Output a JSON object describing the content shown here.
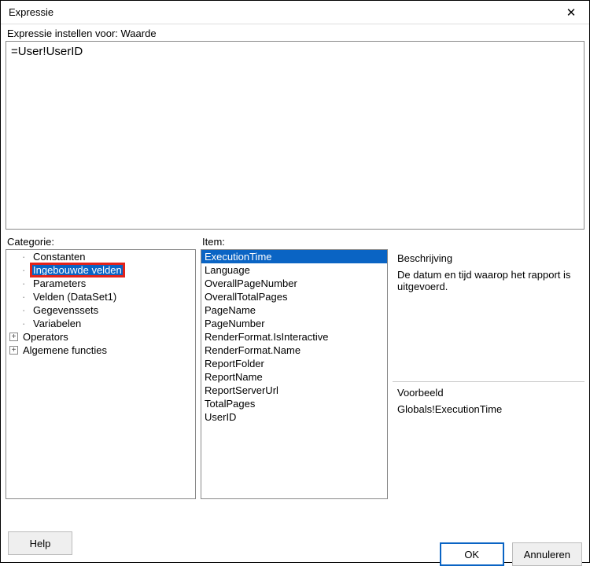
{
  "window": {
    "title": "Expressie",
    "close_glyph": "✕"
  },
  "subheader": "Expressie instellen voor: Waarde",
  "expression_value": "=User!UserID",
  "category": {
    "label": "Categorie:",
    "items": [
      {
        "label": "Constanten",
        "indent": 1,
        "prefix": "dash"
      },
      {
        "label": "Ingebouwde velden",
        "indent": 1,
        "prefix": "dash",
        "selected": true,
        "highlight": true
      },
      {
        "label": "Parameters",
        "indent": 1,
        "prefix": "dash"
      },
      {
        "label": "Velden (DataSet1)",
        "indent": 1,
        "prefix": "dash"
      },
      {
        "label": "Gegevenssets",
        "indent": 1,
        "prefix": "dash"
      },
      {
        "label": "Variabelen",
        "indent": 1,
        "prefix": "dash"
      },
      {
        "label": "Operators",
        "indent": 0,
        "prefix": "plus"
      },
      {
        "label": "Algemene functies",
        "indent": 0,
        "prefix": "plus"
      }
    ]
  },
  "items": {
    "label": "Item:",
    "list": [
      "ExecutionTime",
      "Language",
      "OverallPageNumber",
      "OverallTotalPages",
      "PageName",
      "PageNumber",
      "RenderFormat.IsInteractive",
      "RenderFormat.Name",
      "ReportFolder",
      "ReportName",
      "ReportServerUrl",
      "TotalPages",
      "UserID"
    ],
    "selected_index": 0
  },
  "description": {
    "title": "Beschrijving",
    "text": "De datum en tijd waarop het rapport is uitgevoerd."
  },
  "example": {
    "title": "Voorbeeld",
    "text": "Globals!ExecutionTime"
  },
  "footer": {
    "help": "Help",
    "ok": "OK",
    "cancel": "Annuleren"
  }
}
